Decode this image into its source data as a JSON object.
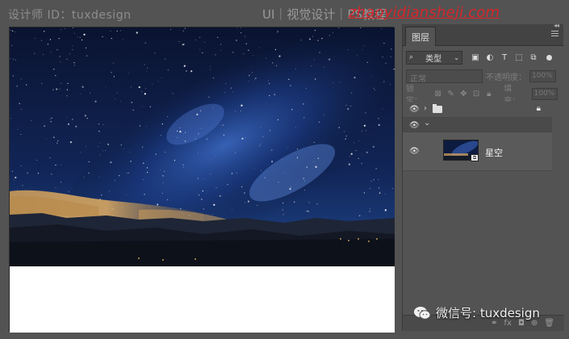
{
  "watermark": {
    "designer_id": "设计师 ID：tuxdesign",
    "category": "UI｜视觉设计｜PS教程",
    "url": "zhaoyidiansheji.com"
  },
  "layers_panel": {
    "tab_label": "图层",
    "filter": {
      "kind_label": "类型",
      "icons": [
        "image-filter-icon",
        "adjustment-filter-icon",
        "type-filter-icon",
        "shape-filter-icon",
        "smart-object-filter-icon"
      ]
    },
    "blend_mode": "正常",
    "opacity_label": "不透明度：",
    "opacity_value": "100%",
    "lock_label": "锁定：",
    "fill_label": "填充：",
    "fill_value": "100%",
    "layers": [
      {
        "type": "group",
        "name": "",
        "visible": true,
        "locked": true
      },
      {
        "type": "expanded-group",
        "name": "",
        "visible": true
      },
      {
        "type": "smart-object",
        "name": "星空",
        "visible": true
      }
    ]
  },
  "wechat": {
    "label": "微信号: tuxdesign"
  },
  "colors": {
    "background": "#535353",
    "panel": "#535353",
    "url_red": "#d8262b",
    "sky_dark": "#0a1226",
    "sky_blue": "#1e3f86"
  }
}
